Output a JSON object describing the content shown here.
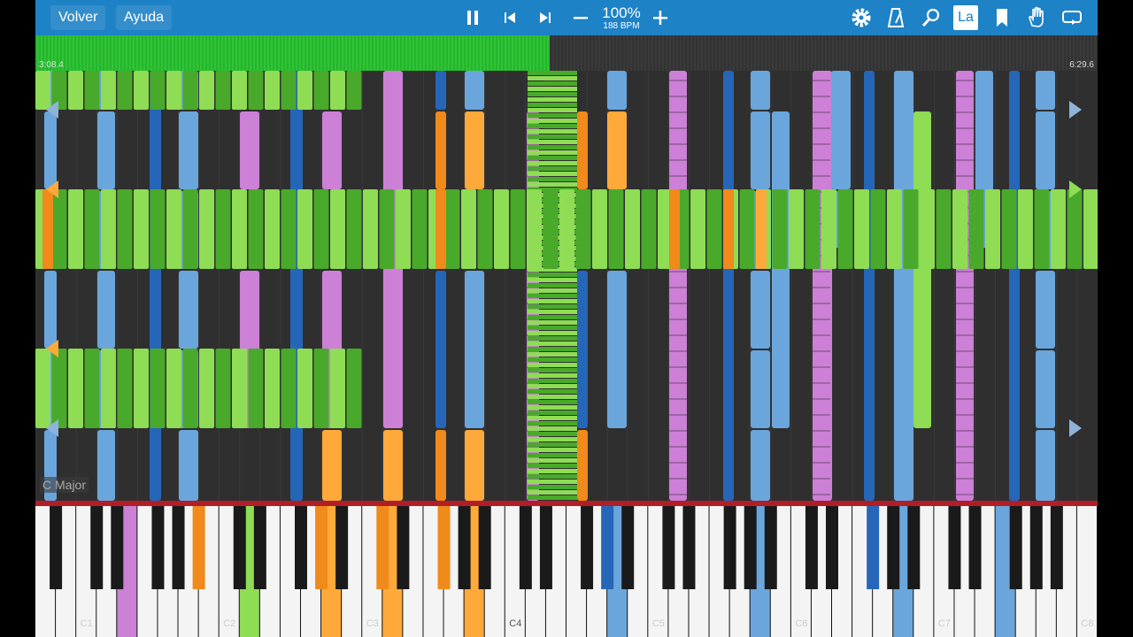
{
  "toolbar": {
    "back_label": "Volver",
    "help_label": "Ayuda",
    "speed_percent": "100%",
    "tempo": "188 BPM"
  },
  "icons": {
    "pause": "pause-icon",
    "previous": "skip-back-icon",
    "next": "skip-forward-icon",
    "minus": "minus-icon",
    "plus": "plus-icon",
    "settings": "gear-icon",
    "metronome": "metronome-icon",
    "search": "search-icon",
    "note_names": "note-label-icon",
    "bookmark": "bookmark-icon",
    "hand": "hand-icon",
    "loop": "loop-icon"
  },
  "note_names_badge": "La",
  "progress": {
    "elapsed": "3:08.4",
    "total": "6:29.6",
    "fraction": 0.484
  },
  "key_signature": "C Major",
  "keyboard": {
    "octave_labels": [
      "C1",
      "C2",
      "C3",
      "C4",
      "C5",
      "C6",
      "C7",
      "C8"
    ]
  },
  "colors": {
    "toolbar": "#1e82c6",
    "green": "#8fdc55",
    "green_dark": "#49a92a",
    "blue_light": "#6aa6dc",
    "blue_dark": "#2666b8",
    "pink": "#cc80d6",
    "orange": "#f08a1a",
    "orange_light": "#ffa93a",
    "keyboard_line": "#b21e28"
  }
}
